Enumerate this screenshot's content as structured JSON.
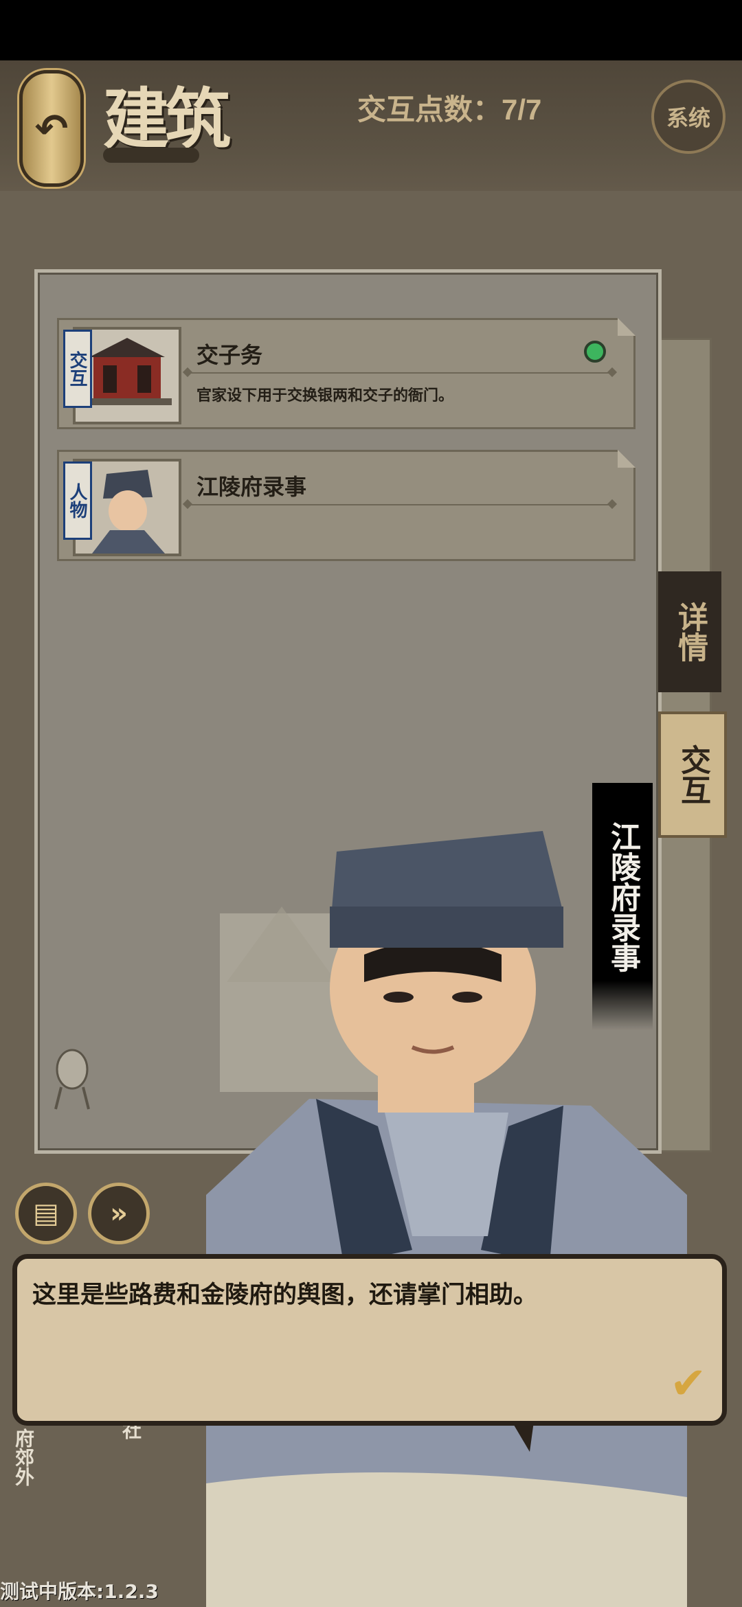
{
  "header": {
    "title": "建筑",
    "interaction_counter": "交互点数：7/7",
    "system_label": "系统",
    "back_icon": "back-arrow-icon"
  },
  "list": {
    "items": [
      {
        "tag": "交互",
        "title": "交子务",
        "description": "官家设下用于交换银两和交子的衙门。",
        "status": "active",
        "status_color": "#3db55e"
      },
      {
        "tag": "人物",
        "title": "江陵府录事",
        "description": ""
      }
    ]
  },
  "side_tabs": {
    "detail": "详情",
    "interact": "交互",
    "selected": "interact"
  },
  "npc": {
    "name": "江陵府录事"
  },
  "dialog": {
    "text": "这里是些路费和金陵府的舆图，还请掌门相助。",
    "confirm_icon": "check-icon"
  },
  "controls": {
    "log_icon": "log-icon",
    "skip_icon": "fast-forward-icon"
  },
  "map_labels": {
    "left": "府郊外",
    "mid": "社"
  },
  "footer": {
    "version": "测试中版本:1.2.3"
  }
}
